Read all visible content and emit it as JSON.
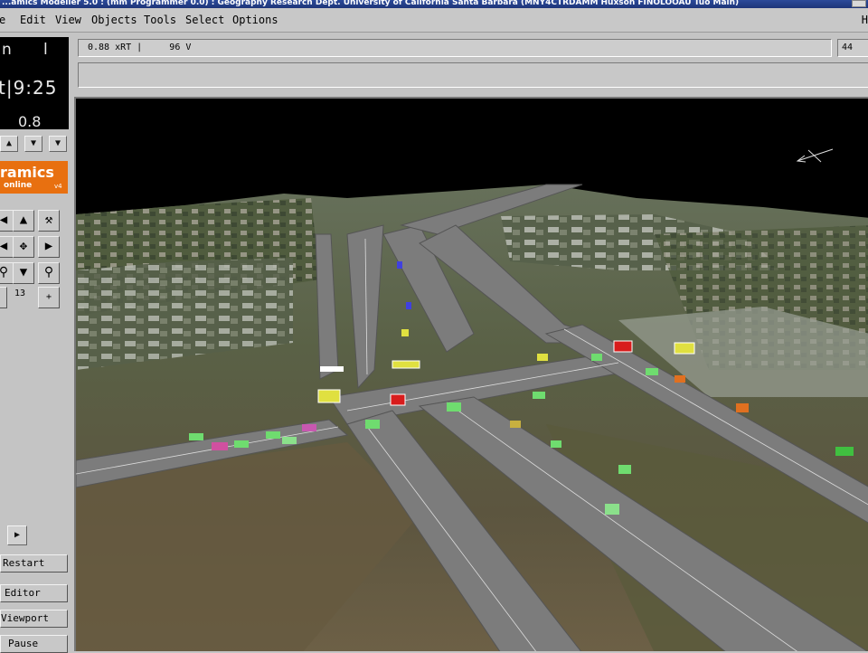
{
  "window": {
    "title": "...amics Modeller 5.0 : (mm Programmer 0.0) : Geography Research Dept. University of California Santa Barbara (MNY4CTRDAMM Huxson FINOLOOAU Tuo Main)"
  },
  "menu": {
    "items": [
      "e",
      "Edit",
      "View",
      "Objects",
      "Tools",
      "Select",
      "Options"
    ],
    "help_fragment": "H"
  },
  "clock": {
    "top_left": "n",
    "top_right": "l",
    "time": "t|9:25",
    "speed": "0.8"
  },
  "logo": {
    "word": "ramics",
    "sub": "online",
    "version": "v4"
  },
  "controls": {
    "step_value": "13",
    "plus_label": "+",
    "play_label": "▶",
    "buttons": [
      "Restart",
      "Editor",
      "Viewport",
      "Pause"
    ]
  },
  "status": {
    "sim_text": "0.88 xRT |     96 V",
    "frame_count": "44"
  },
  "colors": {
    "sky": "#000000",
    "road": "#7c7c7c",
    "logo_orange": "#e87010",
    "vehicle_green": "#6fdc6f",
    "vehicle_red": "#d81c1c"
  }
}
